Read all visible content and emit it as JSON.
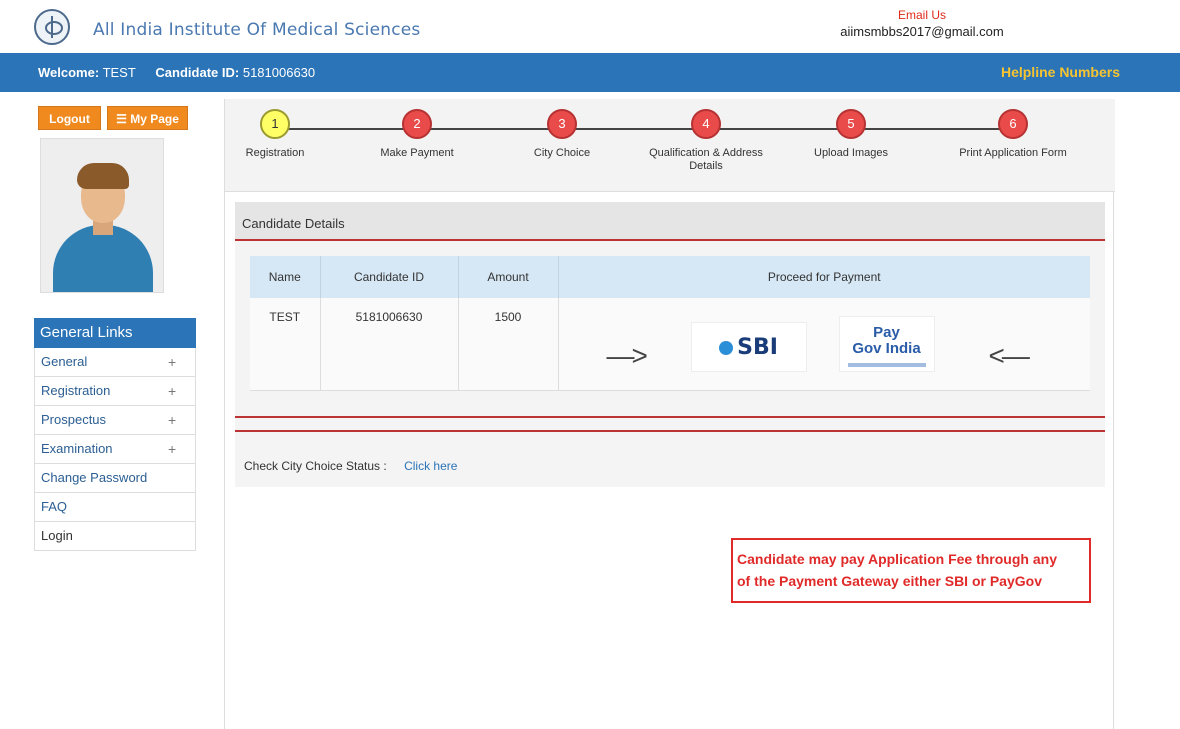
{
  "header": {
    "institute_name": "All India Institute Of Medical Sciences",
    "email_label": "Email Us",
    "email_value": "aiimsmbbs2017@gmail.com"
  },
  "bar": {
    "welcome_label": "Welcome:",
    "welcome_value": "TEST",
    "candidate_label": "Candidate ID:",
    "candidate_value": "5181006630",
    "helpline": "Helpline Numbers"
  },
  "sidebar": {
    "logout": "Logout",
    "mypage": "My Page",
    "general_links_title": "General Links",
    "items": [
      {
        "label": "General",
        "expand": "+"
      },
      {
        "label": "Registration",
        "expand": "+"
      },
      {
        "label": "Prospectus",
        "expand": "+"
      },
      {
        "label": "Examination",
        "expand": "+"
      },
      {
        "label": "Change Password"
      },
      {
        "label": "FAQ"
      },
      {
        "label": "Login"
      }
    ]
  },
  "steps": [
    {
      "num": "1",
      "label": "Registration",
      "active": true
    },
    {
      "num": "2",
      "label": "Make Payment"
    },
    {
      "num": "3",
      "label": "City Choice"
    },
    {
      "num": "4",
      "label": "Qualification & Address Details"
    },
    {
      "num": "5",
      "label": "Upload Images"
    },
    {
      "num": "6",
      "label": "Print Application Form"
    }
  ],
  "candidate_panel": {
    "title": "Candidate Details",
    "columns": [
      "Name",
      "Candidate ID",
      "Amount",
      "Proceed for Payment"
    ],
    "row": {
      "name": "TEST",
      "candidate_id": "5181006630",
      "amount": "1500"
    },
    "sbi_label": "SBI",
    "paygov_line1": "Pay",
    "paygov_line2": "Gov India"
  },
  "city_choice": {
    "label": "Check City Choice Status :",
    "link": "Click here"
  },
  "notice": {
    "line1": "Candidate may pay Application Fee through any",
    "line2": "of the Payment Gateway either SBI or PayGov"
  },
  "colors": {
    "brand_blue": "#2b74b7",
    "accent_orange": "#f08a1e",
    "alert_red": "#e02a2a",
    "helpline_yellow": "#f5c430"
  }
}
